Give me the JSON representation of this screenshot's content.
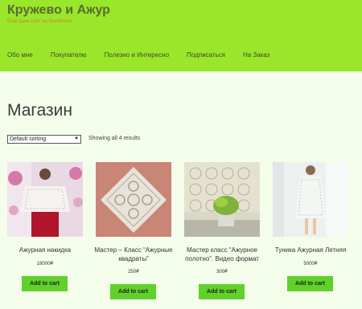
{
  "site": {
    "title": "Кружево и Ажур",
    "description": "Ещё один сайт на WordPress"
  },
  "nav": {
    "items": [
      {
        "label": "Обо мне"
      },
      {
        "label": "Покупателю"
      },
      {
        "label": "Полезно и Интересно"
      },
      {
        "label": "Подписаться"
      },
      {
        "label": "На Заказ"
      }
    ]
  },
  "shop": {
    "title": "Магазин",
    "sorting_value": "Default sorting",
    "results_text": "Showing all 4 results"
  },
  "products": [
    {
      "name": "Ажурная накидка",
      "price": "18000₽",
      "button": "Add to cart"
    },
    {
      "name": "Мастер – Класс “Ажурные квадраты”",
      "price": "250₽",
      "button": "Add to cart"
    },
    {
      "name": "Мастер класс “Ажурное полотно”. Видео формат",
      "price": "300₽",
      "button": "Add to cart"
    },
    {
      "name": "Туника Ажурная Летняя",
      "price": "5000₽",
      "button": "Add to cart"
    }
  ],
  "colors": {
    "header_bg": "#9ae62a",
    "button_bg": "#5fd12a",
    "page_bg": "#f3fdea"
  }
}
